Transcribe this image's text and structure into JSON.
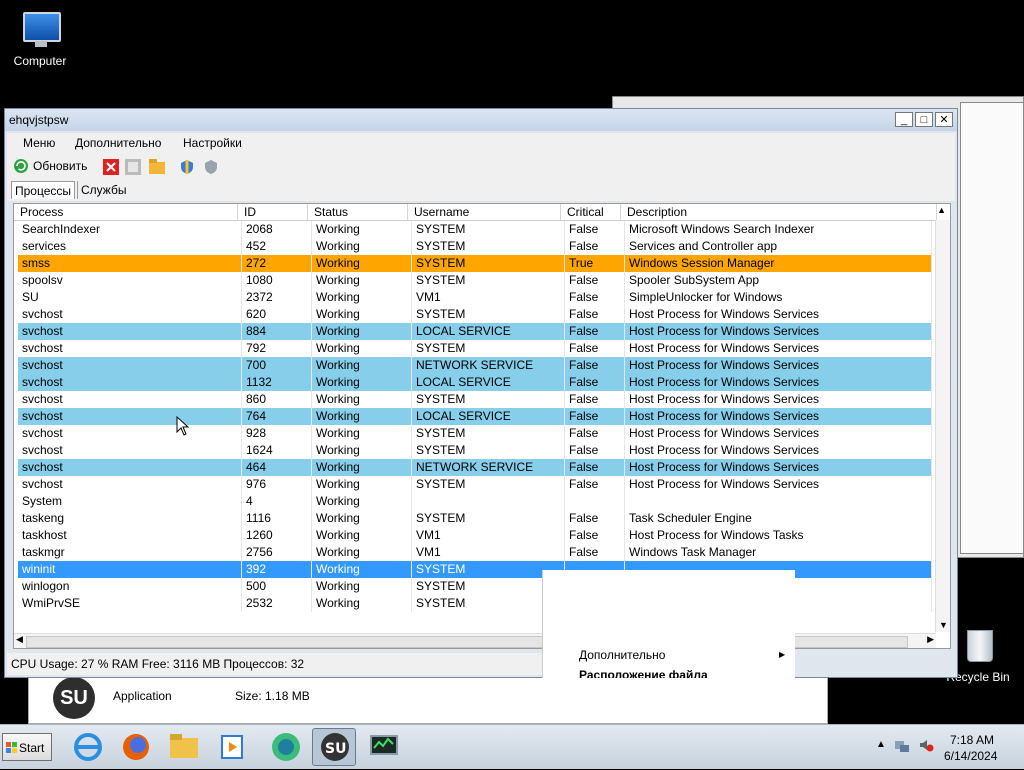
{
  "desktop": {
    "computer_label": "Computer",
    "recycle_bin_label": "Recycle Bin"
  },
  "background_app": {
    "logo_text": "SU",
    "type_label": "Application",
    "size_label": "Size: 1.18 MB"
  },
  "window": {
    "title": "ehqvjstpsw",
    "menu": [
      "Меню",
      "Дополнительно",
      "Настройки"
    ],
    "toolbar": {
      "refresh_label": "Обновить"
    },
    "tabs": [
      "Процессы",
      "Службы"
    ],
    "columns": [
      "Process",
      "ID",
      "Status",
      "Username",
      "Critical",
      "Description"
    ],
    "rows": [
      {
        "process": "SearchIndexer",
        "id": "2068",
        "status": "Working",
        "user": "SYSTEM",
        "critical": "False",
        "desc": "Microsoft Windows Search Indexer",
        "hl": ""
      },
      {
        "process": "services",
        "id": "452",
        "status": "Working",
        "user": "SYSTEM",
        "critical": "False",
        "desc": "Services and Controller app",
        "hl": ""
      },
      {
        "process": "smss",
        "id": "272",
        "status": "Working",
        "user": "SYSTEM",
        "critical": "True",
        "desc": "Windows Session Manager",
        "hl": "orange"
      },
      {
        "process": "spoolsv",
        "id": "1080",
        "status": "Working",
        "user": "SYSTEM",
        "critical": "False",
        "desc": "Spooler SubSystem App",
        "hl": ""
      },
      {
        "process": "SU",
        "id": "2372",
        "status": "Working",
        "user": "VM1",
        "critical": "False",
        "desc": "SimpleUnlocker for Windows",
        "hl": ""
      },
      {
        "process": "svchost",
        "id": "620",
        "status": "Working",
        "user": "SYSTEM",
        "critical": "False",
        "desc": "Host Process for Windows Services",
        "hl": ""
      },
      {
        "process": "svchost",
        "id": "884",
        "status": "Working",
        "user": "LOCAL SERVICE",
        "critical": "False",
        "desc": "Host Process for Windows Services",
        "hl": "blue"
      },
      {
        "process": "svchost",
        "id": "792",
        "status": "Working",
        "user": "SYSTEM",
        "critical": "False",
        "desc": "Host Process for Windows Services",
        "hl": ""
      },
      {
        "process": "svchost",
        "id": "700",
        "status": "Working",
        "user": "NETWORK SERVICE",
        "critical": "False",
        "desc": "Host Process for Windows Services",
        "hl": "blue"
      },
      {
        "process": "svchost",
        "id": "1132",
        "status": "Working",
        "user": "LOCAL SERVICE",
        "critical": "False",
        "desc": "Host Process for Windows Services",
        "hl": "blue"
      },
      {
        "process": "svchost",
        "id": "860",
        "status": "Working",
        "user": "SYSTEM",
        "critical": "False",
        "desc": "Host Process for Windows Services",
        "hl": ""
      },
      {
        "process": "svchost",
        "id": "764",
        "status": "Working",
        "user": "LOCAL SERVICE",
        "critical": "False",
        "desc": "Host Process for Windows Services",
        "hl": "blue"
      },
      {
        "process": "svchost",
        "id": "928",
        "status": "Working",
        "user": "SYSTEM",
        "critical": "False",
        "desc": "Host Process for Windows Services",
        "hl": ""
      },
      {
        "process": "svchost",
        "id": "1624",
        "status": "Working",
        "user": "SYSTEM",
        "critical": "False",
        "desc": "Host Process for Windows Services",
        "hl": ""
      },
      {
        "process": "svchost",
        "id": "464",
        "status": "Working",
        "user": "NETWORK SERVICE",
        "critical": "False",
        "desc": "Host Process for Windows Services",
        "hl": "blue"
      },
      {
        "process": "svchost",
        "id": "976",
        "status": "Working",
        "user": "SYSTEM",
        "critical": "False",
        "desc": "Host Process for Windows Services",
        "hl": ""
      },
      {
        "process": "System",
        "id": "4",
        "status": "Working",
        "user": "",
        "critical": "",
        "desc": "",
        "hl": ""
      },
      {
        "process": "taskeng",
        "id": "1116",
        "status": "Working",
        "user": "SYSTEM",
        "critical": "False",
        "desc": "Task Scheduler Engine",
        "hl": ""
      },
      {
        "process": "taskhost",
        "id": "1260",
        "status": "Working",
        "user": "VM1",
        "critical": "False",
        "desc": "Host Process for Windows Tasks",
        "hl": ""
      },
      {
        "process": "taskmgr",
        "id": "2756",
        "status": "Working",
        "user": "VM1",
        "critical": "False",
        "desc": "Windows Task Manager",
        "hl": ""
      },
      {
        "process": "wininit",
        "id": "392",
        "status": "Working",
        "user": "SYSTEM",
        "critical": "",
        "desc": "",
        "hl": "sel"
      },
      {
        "process": "winlogon",
        "id": "500",
        "status": "Working",
        "user": "SYSTEM",
        "critical": "",
        "desc": "",
        "hl": ""
      },
      {
        "process": "WmiPrvSE",
        "id": "2532",
        "status": "Working",
        "user": "SYSTEM",
        "critical": "",
        "desc": "",
        "hl": ""
      }
    ],
    "status_bar": "CPU Usage: 27 %  RAM Free: 3116 MB  Процессов: 32"
  },
  "context_menu": {
    "item_more": "Дополнительно",
    "item_location": "Расположение файла"
  },
  "taskbar": {
    "start_label": "Start",
    "time": "7:18 AM",
    "date": "6/14/2024"
  }
}
